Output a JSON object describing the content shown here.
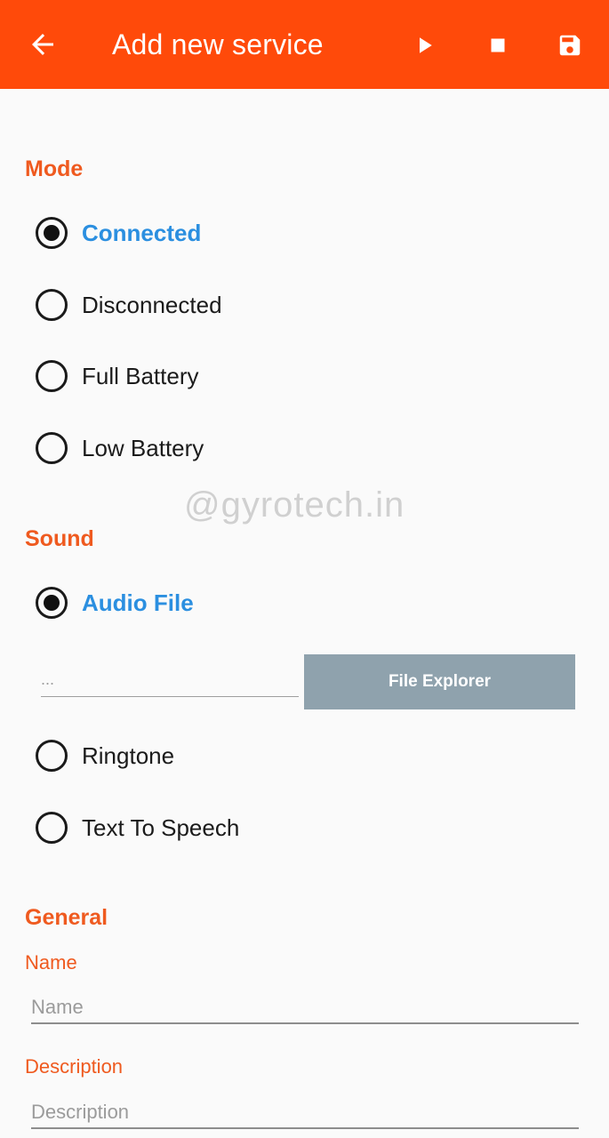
{
  "appbar": {
    "title": "Add new service",
    "background": "#ff4a0a",
    "icons": {
      "back": "arrow-back-icon",
      "play": "play-icon",
      "stop": "stop-icon",
      "save": "floppy-disk-icon"
    }
  },
  "mode": {
    "title": "Mode",
    "options": [
      {
        "label": "Connected",
        "selected": true
      },
      {
        "label": "Disconnected",
        "selected": false
      },
      {
        "label": "Full Battery",
        "selected": false
      },
      {
        "label": "Low Battery",
        "selected": false
      }
    ]
  },
  "watermark": "@gyrotech.in",
  "sound": {
    "title": "Sound",
    "options": [
      {
        "label": "Audio File",
        "selected": true
      },
      {
        "label": "Ringtone",
        "selected": false
      },
      {
        "label": "Text To Speech",
        "selected": false
      }
    ],
    "file_path_placeholder": "...",
    "file_explorer_label": "File Explorer"
  },
  "general": {
    "title": "General",
    "name_label": "Name",
    "name_placeholder": "Name",
    "description_label": "Description",
    "description_placeholder": "Description"
  },
  "colors": {
    "accent": "#ef5a1f",
    "selected": "#2b8fe0",
    "button": "#8fa2ad"
  }
}
